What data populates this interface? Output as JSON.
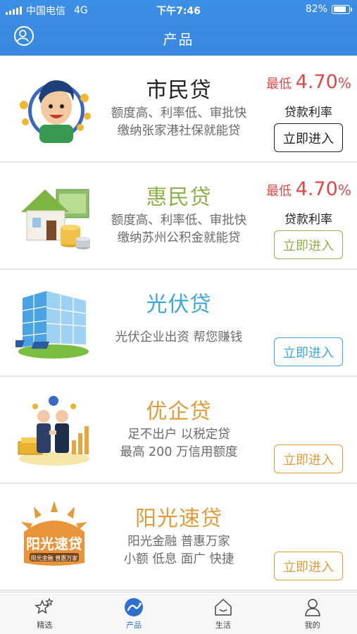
{
  "status_bar": {
    "carrier": "中国电信",
    "network": "4G",
    "time": "下午7:46",
    "battery": "82%",
    "battery_level": 0.82
  },
  "header": {
    "title": "产品"
  },
  "products": [
    {
      "name": "市民贷",
      "desc": [
        "额度高、利率低、审批快",
        "缴纳张家港社保就能贷"
      ],
      "rate_prefix": "最低",
      "rate_value": "4.70",
      "rate_unit": "%",
      "rate_label": "贷款利率",
      "button": "立即进入",
      "color": "#222222",
      "icon": "man-with-coins-icon"
    },
    {
      "name": "惠民贷",
      "desc": [
        "额度高、利率低、审批快",
        "缴纳苏州公积金就能贷"
      ],
      "rate_prefix": "最低",
      "rate_value": "4.70",
      "rate_unit": "%",
      "rate_label": "贷款利率",
      "button": "立即进入",
      "color": "#8fb14b",
      "icon": "house-with-money-icon"
    },
    {
      "name": "光伏贷",
      "desc": [
        "光伏企业出资 帮您赚钱"
      ],
      "button": "立即进入",
      "color": "#3aa8de",
      "icon": "solar-panel-building-icon"
    },
    {
      "name": "优企贷",
      "desc": [
        "足不出户 以税定贷",
        "最高 200 万信用额度"
      ],
      "button": "立即进入",
      "color": "#e19b3a",
      "icon": "business-handshake-icon"
    },
    {
      "name": "阳光速贷",
      "desc": [
        "阳光金融 普惠万家",
        "小额 低息 面广 快捷"
      ],
      "button": "立即进入",
      "color": "#e19b3a",
      "icon": "sunshine-loan-logo-icon",
      "logo_text": "阳光速贷",
      "logo_subtext": "阳光金融 普惠万家"
    }
  ],
  "tabbar": [
    {
      "label": "精选",
      "icon": "stars-icon",
      "active": false
    },
    {
      "label": "产品",
      "icon": "product-icon",
      "active": true
    },
    {
      "label": "生活",
      "icon": "house-smile-icon",
      "active": false
    },
    {
      "label": "我的",
      "icon": "person-icon",
      "active": false
    }
  ]
}
